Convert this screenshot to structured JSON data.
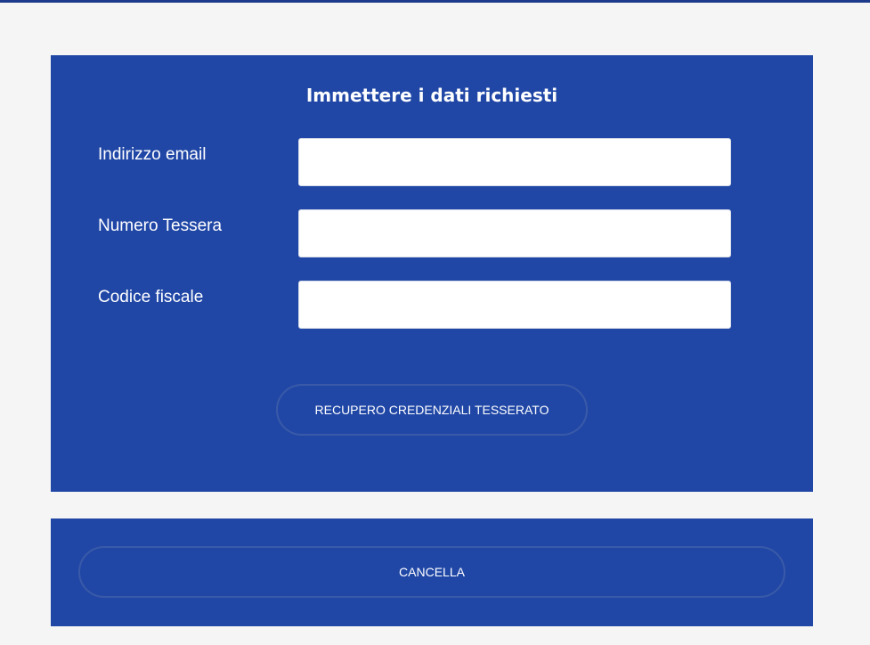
{
  "form": {
    "title": "Immettere i dati richiesti",
    "fields": [
      {
        "label": "Indirizzo email",
        "value": "",
        "placeholder": ""
      },
      {
        "label": "Numero Tessera",
        "value": "",
        "placeholder": ""
      },
      {
        "label": "Codice fiscale",
        "value": "",
        "placeholder": ""
      }
    ],
    "submit_label": "RECUPERO CREDENZIALI TESSERATO"
  },
  "cancel": {
    "label": "CANCELLA"
  },
  "colors": {
    "panel_background": "#2047a6",
    "page_background": "#f5f5f5",
    "top_bar": "#1e3a8a",
    "button_border": "#3a5aa8",
    "text": "#ffffff"
  }
}
